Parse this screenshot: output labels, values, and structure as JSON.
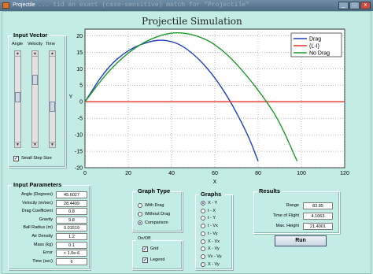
{
  "window": {
    "title": "Projectile",
    "ghost_text": "...  tid an exact (case-sensitive) match for \"Projectile\"",
    "min": "_",
    "max": "□",
    "close": "x"
  },
  "plot": {
    "title": "Projectile Simulation",
    "xlabel": "X",
    "ylabel": "Y",
    "xticks": [
      "0",
      "20",
      "40",
      "60",
      "80",
      "100",
      "120"
    ],
    "yticks": [
      "20",
      "15",
      "10",
      "5",
      "0",
      "-5",
      "-10",
      "-15",
      "-20"
    ],
    "legend": [
      "Drag",
      "(L-I)",
      "No Drag"
    ],
    "colors": {
      "drag": "#1f3fbf",
      "middle": "#e8322a",
      "nodrag": "#1e9a2a"
    }
  },
  "chart_data": {
    "type": "line",
    "xlim": [
      0,
      120
    ],
    "ylim": [
      -20,
      22
    ],
    "grid": true,
    "legend_position": "top-right",
    "series": [
      {
        "name": "Drag",
        "x": [
          0,
          10,
          20,
          30,
          37,
          45,
          55,
          65,
          75,
          80
        ],
        "y": [
          0,
          10.2,
          15.8,
          18.4,
          18.8,
          17.2,
          11.6,
          2.8,
          -9.5,
          -18
        ]
      },
      {
        "name": "(L-I)",
        "x": [
          0,
          120
        ],
        "y": [
          0,
          0
        ]
      },
      {
        "name": "No Drag",
        "x": [
          0,
          10,
          20,
          30,
          42,
          55,
          65,
          75,
          84,
          90,
          98
        ],
        "y": [
          0,
          8.7,
          15,
          19.1,
          21.4,
          19.5,
          15,
          7.8,
          0,
          -6.2,
          -18
        ]
      }
    ]
  },
  "input_vector": {
    "title": "Input Vector",
    "labels": [
      "Angle",
      "Velocity",
      "Time"
    ],
    "small_step": "Small Step Size"
  },
  "input_params": {
    "title": "Input Parameters",
    "rows": [
      {
        "label": "Angle (Degrees)",
        "value": "45.6027"
      },
      {
        "label": "Velocity (m/sec)",
        "value": "28.4409"
      },
      {
        "label": "Drag Coefficient",
        "value": "0.8"
      },
      {
        "label": "Gravity",
        "value": "9.8"
      },
      {
        "label": "Ball Radius (m)",
        "value": "0.01519"
      },
      {
        "label": "Air Density",
        "value": "1.2"
      },
      {
        "label": "Mass (kg)",
        "value": "0.1"
      },
      {
        "label": "Error",
        "value": "< 1.0e-6"
      },
      {
        "label": "Time (sec)",
        "value": "6"
      }
    ]
  },
  "graph_type": {
    "title": "Graph Type",
    "options": [
      "With Drag",
      "Without Drag",
      "Comparison"
    ],
    "selected": 2
  },
  "onoff": {
    "title": "On/Off",
    "grid": "Grid",
    "legend": "Legend"
  },
  "graphs": {
    "title": "Graphs",
    "options": [
      "X - Y",
      "t - X",
      "t - Y",
      "t - Vx",
      "t - Vy",
      "X - Vx",
      "X - Vy",
      "Vx - Vy",
      "X - Vy"
    ],
    "selected": 0
  },
  "results": {
    "title": "Results",
    "rows": [
      {
        "label": "Range",
        "value": "83.85"
      },
      {
        "label": "Time of Flight",
        "value": "4.1063"
      },
      {
        "label": "Max. Height",
        "value": "21.4001"
      }
    ]
  },
  "run_label": "Run"
}
